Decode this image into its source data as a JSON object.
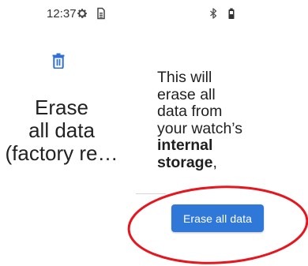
{
  "status_bar": {
    "time": "12:37",
    "icons": [
      "gear-icon",
      "sim-card-icon",
      "bluetooth-icon",
      "battery-icon"
    ]
  },
  "left_panel": {
    "icon": "trash-icon",
    "accent_color": "#2f6fd6",
    "title_lines": [
      "Erase",
      "all data",
      "(factory re…"
    ]
  },
  "right_panel": {
    "description": {
      "line1": "This will",
      "line2": "erase all",
      "line3": "data from",
      "line4": "your watch’s",
      "line5": "internal",
      "line6_bold": "storage",
      "line6_rest": ","
    }
  },
  "action": {
    "button_label": "Erase all data",
    "button_color": "#2f78d8"
  },
  "annotation": {
    "shape": "ellipse",
    "color": "#e5161d"
  }
}
